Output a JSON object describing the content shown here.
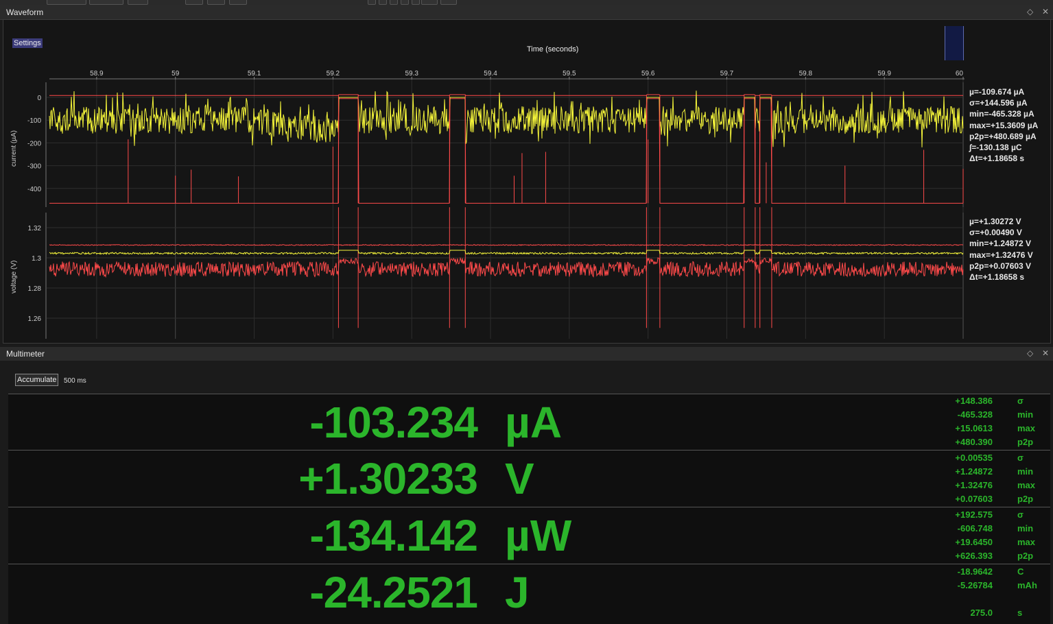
{
  "waveform": {
    "title": "Waveform",
    "settings_label": "Settings",
    "x_title": "Time (seconds)",
    "x_ticks": [
      "58.9",
      "59",
      "59.1",
      "59.2",
      "59.3",
      "59.4",
      "59.5",
      "59.6",
      "59.7",
      "59.8",
      "59.9",
      "60"
    ],
    "current": {
      "ylabel": "current (µA)",
      "yticks": [
        "0",
        "-100",
        "-200",
        "-300",
        "-400"
      ],
      "stats": [
        "µ=-109.674 µA",
        "σ=+144.596 µA",
        "min=-465.328 µA",
        "max=+15.3609 µA",
        "p2p=+480.689 µA",
        "∫=-130.138 µC",
        "Δt=+1.18658  s"
      ]
    },
    "voltage": {
      "ylabel": "voltage (V)",
      "yticks": [
        "1.32",
        "1.3",
        "1.28",
        "1.26"
      ],
      "stats": [
        "µ=+1.30272  V",
        "σ=+0.00490  V",
        "min=+1.24872  V",
        "max=+1.32476  V",
        "p2p=+0.07603  V",
        "Δt=+1.18658  s"
      ]
    },
    "colors": {
      "mean": "#f5f53a",
      "extrema": "#ff4a4a",
      "grid": "#3a3a3a"
    }
  },
  "chart_data": [
    {
      "type": "line",
      "xlabel": "Time (seconds)",
      "ylabel": "current (µA)",
      "xlim": [
        58.84,
        60
      ],
      "ylim": [
        -470,
        20
      ],
      "series": [
        {
          "values_hint": "mean trace ~ -100 µA, rises to ~0 µA in gaps 59.21-59.23, 59.35-59.37, 59.60-59.62, 59.72-59.76"
        },
        {
          "values_hint": "min/max envelope: max ~ +10 µA, min ~ -465 µA"
        }
      ]
    },
    {
      "type": "line",
      "xlabel": "Time (seconds)",
      "ylabel": "voltage (V)",
      "xlim": [
        58.84,
        60
      ],
      "ylim": [
        1.252,
        1.334
      ],
      "series": [
        {
          "values_hint": "mean trace ~ 1.303 V"
        },
        {
          "values_hint": "min/max envelope: max ~ 1.3085 V, min ~ 1.28-1.298 V"
        }
      ]
    }
  ],
  "multimeter": {
    "title": "Multimeter",
    "accumulate_label": "Accumulate",
    "period": "500 ms",
    "rows": [
      {
        "value": "-103.234",
        "unit": "µA",
        "stats": [
          [
            "+148.386",
            "σ"
          ],
          [
            "-465.328",
            "min"
          ],
          [
            "+15.0613",
            "max"
          ],
          [
            "+480.390",
            "p2p"
          ]
        ]
      },
      {
        "value": "+1.30233",
        "unit": "V",
        "stats": [
          [
            "+0.00535",
            "σ"
          ],
          [
            "+1.24872",
            "min"
          ],
          [
            "+1.32476",
            "max"
          ],
          [
            "+0.07603",
            "p2p"
          ]
        ]
      },
      {
        "value": "-134.142",
        "unit": "µW",
        "stats": [
          [
            "+192.575",
            "σ"
          ],
          [
            "-606.748",
            "min"
          ],
          [
            "+19.6450",
            "max"
          ],
          [
            "+626.393",
            "p2p"
          ]
        ]
      },
      {
        "value": "-24.2521",
        "unit": "J",
        "stats": [
          [
            "-18.9642",
            "C"
          ],
          [
            "-5.26784",
            "mAh"
          ],
          [
            "",
            ""
          ],
          [
            "275.0",
            "s"
          ]
        ]
      }
    ],
    "color": "#2bb52b"
  }
}
